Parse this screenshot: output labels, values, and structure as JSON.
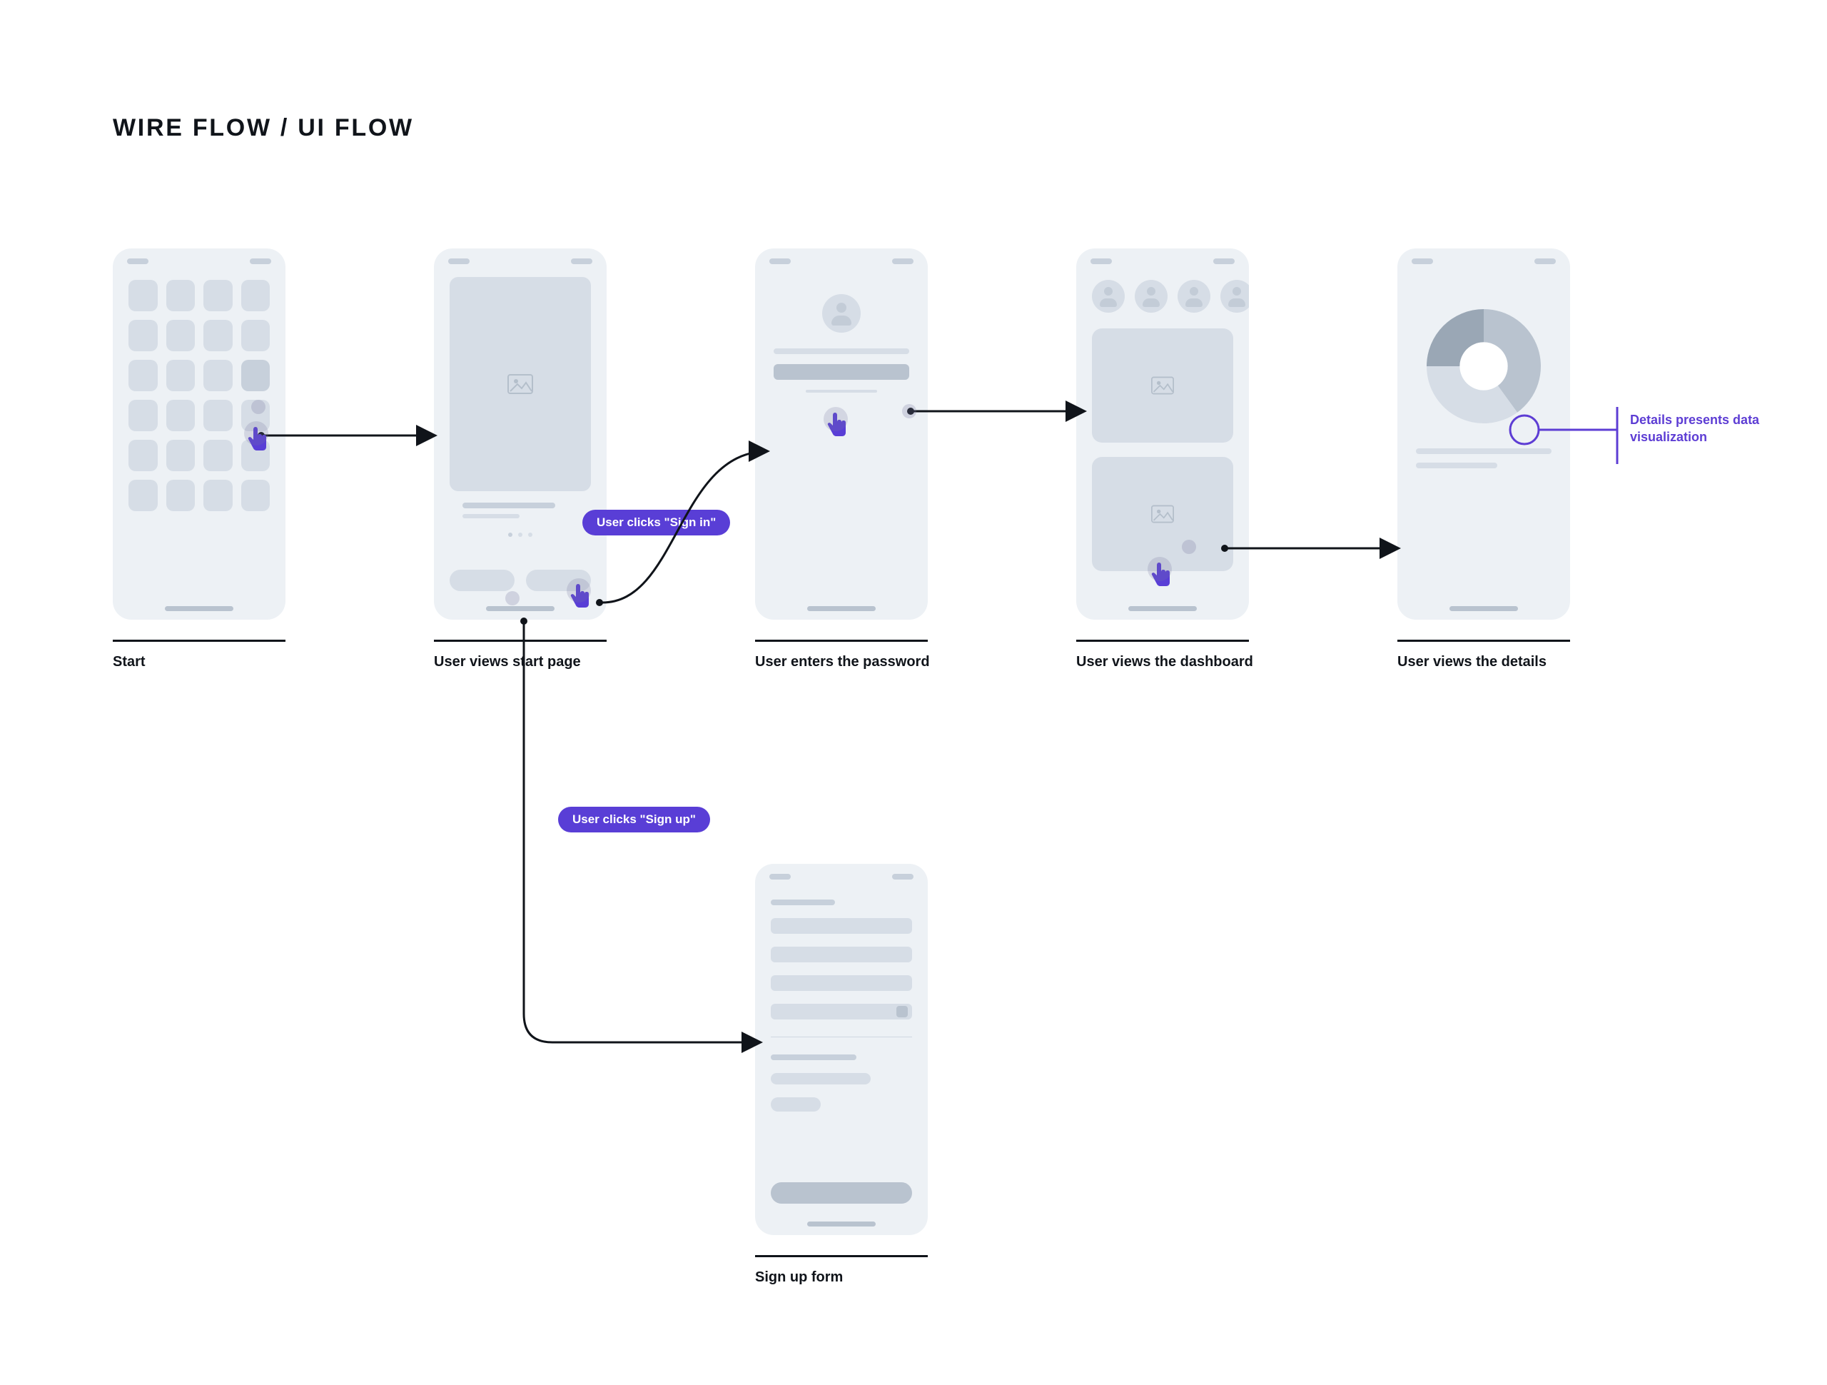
{
  "title": "WIRE FLOW / UI FLOW",
  "screens": {
    "start": {
      "caption": "Start"
    },
    "onboarding": {
      "caption": "User views start page"
    },
    "password": {
      "caption": "User enters the password"
    },
    "dashboard": {
      "caption": "User views  the dashboard"
    },
    "details": {
      "caption": "User views  the details"
    },
    "signup": {
      "caption": "Sign up form"
    }
  },
  "actions": {
    "sign_in": "User clicks \"Sign in\"",
    "sign_up": "User clicks \"Sign up\""
  },
  "annotation": "Details presents data visualization",
  "colors": {
    "accent": "#5d3dd4",
    "phone_bg": "#edf1f5"
  },
  "chart_data": {
    "type": "pie",
    "title": "",
    "values": [
      40,
      35,
      25
    ],
    "colors": [
      "#b9c3cf",
      "#d6dde6",
      "#9aa7b5"
    ],
    "donut_hole": 0.42
  }
}
